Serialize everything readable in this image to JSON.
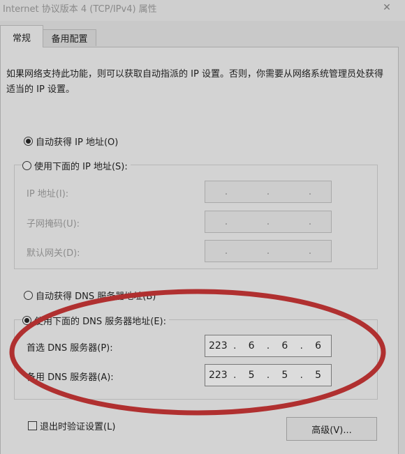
{
  "window": {
    "title": "Internet 协议版本 4 (TCP/IPv4) 属性",
    "close_glyph": "✕"
  },
  "tabs": [
    {
      "label": "常规",
      "active": true
    },
    {
      "label": "备用配置",
      "active": false
    }
  ],
  "intro_text": "如果网络支持此功能，则可以获取自动指派的 IP 设置。否则，你需要从网络系统管理员处获得适当的 IP 设置。",
  "ip_section": {
    "auto_label": "自动获得 IP 地址(O)",
    "manual_label": "使用下面的 IP 地址(S):",
    "selected": "auto",
    "fields": [
      {
        "label": "IP 地址(I):",
        "octets": [
          "",
          "",
          "",
          ""
        ]
      },
      {
        "label": "子网掩码(U):",
        "octets": [
          "",
          "",
          "",
          ""
        ]
      },
      {
        "label": "默认网关(D):",
        "octets": [
          "",
          "",
          "",
          ""
        ]
      }
    ]
  },
  "dns_section": {
    "auto_label": "自动获得 DNS 服务器地址(B)",
    "manual_label": "使用下面的 DNS 服务器地址(E):",
    "selected": "manual",
    "fields": [
      {
        "label": "首选 DNS 服务器(P):",
        "octets": [
          "223",
          "6",
          "6",
          "6"
        ]
      },
      {
        "label": "备用 DNS 服务器(A):",
        "octets": [
          "223",
          "5",
          "5",
          "5"
        ]
      }
    ]
  },
  "validate_on_exit": {
    "label": "退出时验证设置(L)",
    "checked": false
  },
  "advanced_button": "高级(V)...",
  "annotation_color": "#b03030"
}
